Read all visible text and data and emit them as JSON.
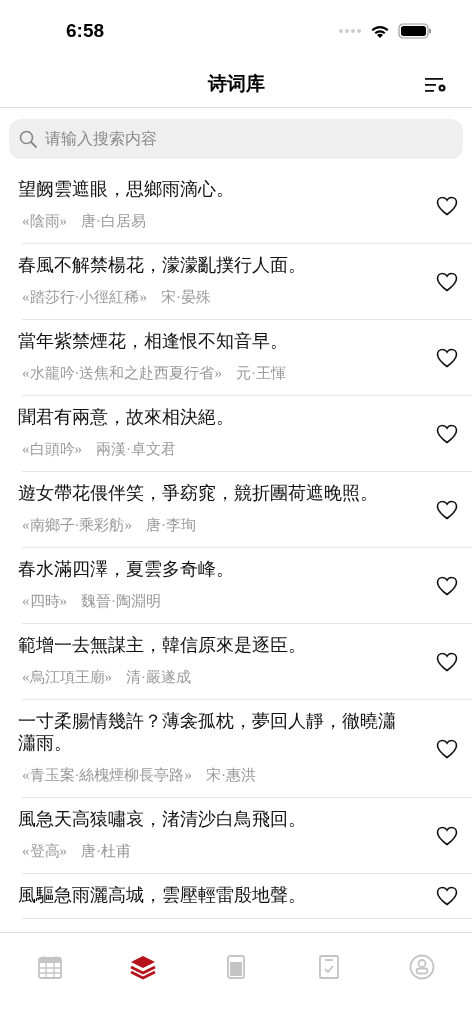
{
  "status_bar": {
    "time": "6:58"
  },
  "header": {
    "title": "诗词库"
  },
  "search": {
    "placeholder": "请输入搜索内容"
  },
  "poems": [
    {
      "verse": "望阙雲遮眼，思鄉雨滴心。",
      "source": "«陰雨»",
      "author": "唐·白居易",
      "liked": false
    },
    {
      "verse": "春風不解禁楊花，濛濛亂撲行人面。",
      "source": "«踏莎行·小徑紅稀»",
      "author": "宋·晏殊",
      "liked": false
    },
    {
      "verse": "當年紫禁煙花，相逢恨不知音早。",
      "source": "«水龍吟·送焦和之赴西夏行省»",
      "author": "元·王惲",
      "liked": false
    },
    {
      "verse": "聞君有兩意，故來相決絕。",
      "source": "«白頭吟»",
      "author": "兩漢·卓文君",
      "liked": false
    },
    {
      "verse": "遊女帶花偎伴笑，爭窈窕，競折團荷遮晚照。",
      "source": "«南鄉子·乘彩舫»",
      "author": "唐·李珣",
      "liked": false
    },
    {
      "verse": "春水滿四澤，夏雲多奇峰。",
      "source": "«四時»",
      "author": "魏晉·陶淵明",
      "liked": false
    },
    {
      "verse": "範增一去無謀主，韓信原來是逐臣。",
      "source": "«烏江項王廟»",
      "author": "清·嚴遂成",
      "liked": false
    },
    {
      "verse": "一寸柔腸情幾許？薄衾孤枕，夢回人靜，徹曉瀟瀟雨。",
      "source": "«青玉案·絲槐煙柳長亭路»",
      "author": "宋·惠洪",
      "liked": false
    },
    {
      "verse": "風急天高猿嘯哀，渚清沙白鳥飛回。",
      "source": "«登高»",
      "author": "唐·杜甫",
      "liked": false
    },
    {
      "verse": "風驅急雨灑高城，雲壓輕雷殷地聲。",
      "liked": false
    }
  ],
  "tab_bar": [
    {
      "kind": "calendar",
      "selected": false
    },
    {
      "kind": "layers",
      "selected": true
    },
    {
      "kind": "book",
      "selected": false
    },
    {
      "kind": "checklist",
      "selected": false
    },
    {
      "kind": "profile",
      "selected": false
    }
  ]
}
